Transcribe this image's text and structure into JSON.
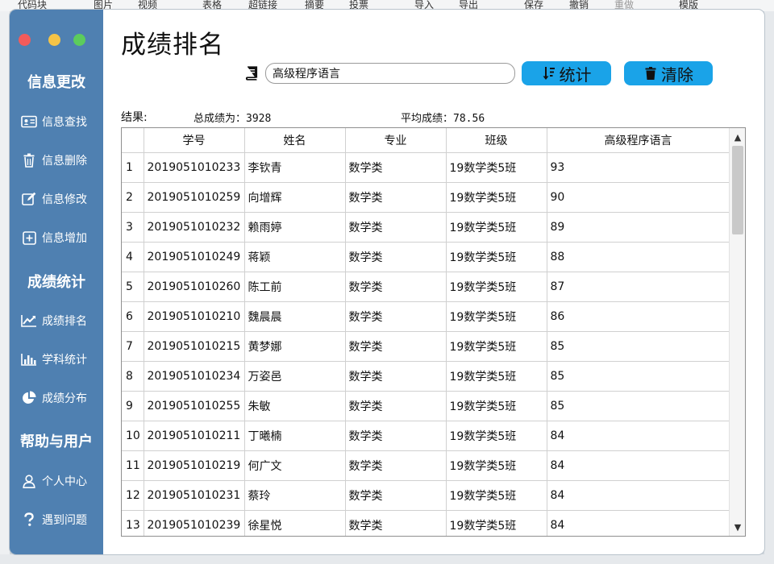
{
  "background_menu": [
    "代码块",
    "图片",
    "视频",
    "表格",
    "超链接",
    "摘要",
    "投票",
    "导入",
    "导出",
    "保存",
    "撤销",
    "重做",
    "模版"
  ],
  "window": {
    "title": "成绩排名"
  },
  "sidebar": {
    "sections": [
      {
        "title": "信息更改",
        "items": [
          {
            "label": "信息查找",
            "icon": "id-card-icon"
          },
          {
            "label": "信息删除",
            "icon": "trash-icon"
          },
          {
            "label": "信息修改",
            "icon": "edit-icon"
          },
          {
            "label": "信息增加",
            "icon": "plus-box-icon"
          }
        ]
      },
      {
        "title": "成绩统计",
        "items": [
          {
            "label": "成绩排名",
            "icon": "line-chart-icon"
          },
          {
            "label": "学科统计",
            "icon": "bar-chart-icon"
          },
          {
            "label": "成绩分布",
            "icon": "pie-chart-icon"
          }
        ]
      },
      {
        "title": "帮助与用户",
        "items": [
          {
            "label": "个人中心",
            "icon": "user-icon"
          },
          {
            "label": "遇到问题",
            "icon": "question-icon"
          }
        ]
      }
    ]
  },
  "toolbar": {
    "course_value": "高级程序语言",
    "stat_label": "统计",
    "clear_label": "清除"
  },
  "summary": {
    "result_label": "结果:",
    "total_label": "总成绩为：",
    "total_value": "3928",
    "avg_label": "平均成绩：",
    "avg_value": "78.56"
  },
  "table": {
    "headers": [
      "学号",
      "姓名",
      "专业",
      "班级",
      "高级程序语言"
    ],
    "rows": [
      [
        "1",
        "2019051010233",
        "李钦青",
        "数学类",
        "19数学类5班",
        "93"
      ],
      [
        "2",
        "2019051010259",
        "向增辉",
        "数学类",
        "19数学类5班",
        "90"
      ],
      [
        "3",
        "2019051010232",
        "赖雨婷",
        "数学类",
        "19数学类5班",
        "89"
      ],
      [
        "4",
        "2019051010249",
        "蒋颖",
        "数学类",
        "19数学类5班",
        "88"
      ],
      [
        "5",
        "2019051010260",
        "陈工前",
        "数学类",
        "19数学类5班",
        "87"
      ],
      [
        "6",
        "2019051010210",
        "魏晨晨",
        "数学类",
        "19数学类5班",
        "86"
      ],
      [
        "7",
        "2019051010215",
        "黄梦娜",
        "数学类",
        "19数学类5班",
        "85"
      ],
      [
        "8",
        "2019051010234",
        "万姿邑",
        "数学类",
        "19数学类5班",
        "85"
      ],
      [
        "9",
        "2019051010255",
        "朱敏",
        "数学类",
        "19数学类5班",
        "85"
      ],
      [
        "10",
        "2019051010211",
        "丁曦楠",
        "数学类",
        "19数学类5班",
        "84"
      ],
      [
        "11",
        "2019051010219",
        "何广文",
        "数学类",
        "19数学类5班",
        "84"
      ],
      [
        "12",
        "2019051010231",
        "蔡玲",
        "数学类",
        "19数学类5班",
        "84"
      ],
      [
        "13",
        "2019051010239",
        "徐星悦",
        "数学类",
        "19数学类5班",
        "84"
      ]
    ]
  },
  "colors": {
    "sidebar": "#4f80b1",
    "button": "#1aa3e8"
  }
}
